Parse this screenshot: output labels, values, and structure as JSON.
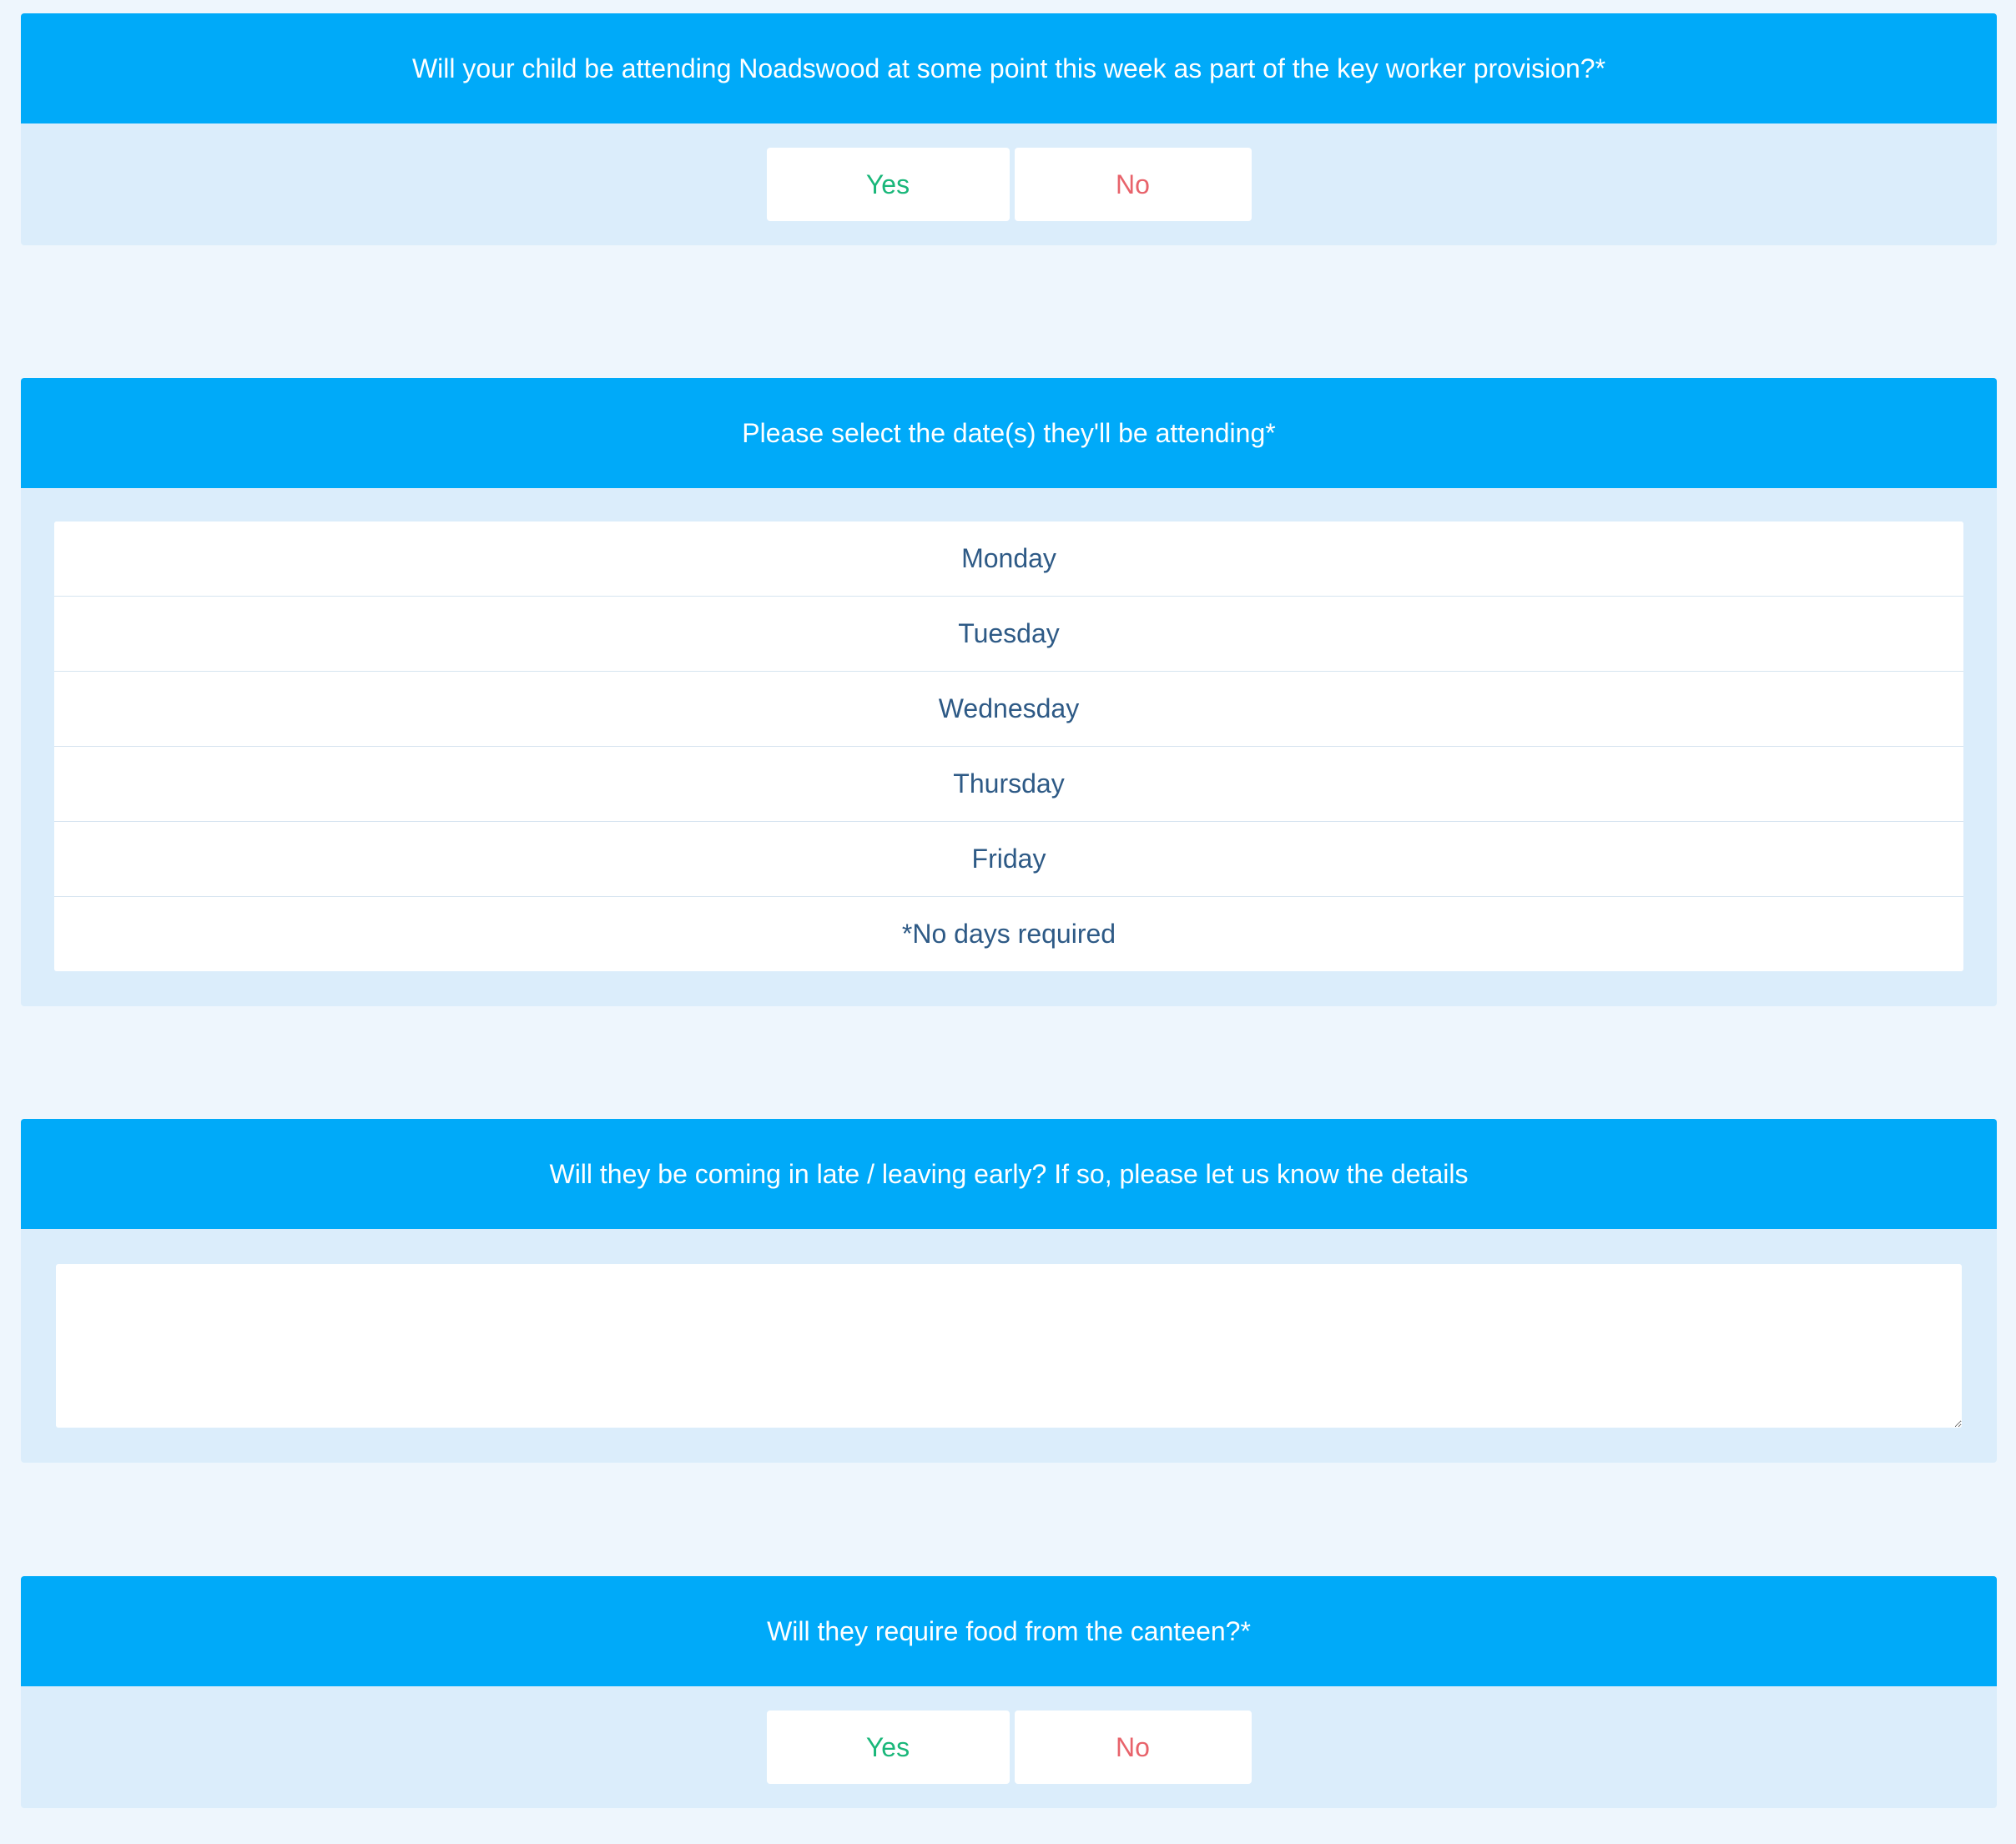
{
  "questions": {
    "attending": {
      "title": "Will your child be attending Noadswood at some point this week as part of the key worker provision?*",
      "yes_label": "Yes",
      "no_label": "No"
    },
    "dates": {
      "title": "Please select the date(s) they'll be attending*",
      "options": [
        "Monday",
        "Tuesday",
        "Wednesday",
        "Thursday",
        "Friday",
        "*No days required"
      ]
    },
    "times": {
      "title": "Will they be coming in late / leaving early? If so, please let us know the details",
      "value": "",
      "placeholder": ""
    },
    "food": {
      "title": "Will they require food from the canteen?*",
      "yes_label": "Yes",
      "no_label": "No"
    }
  },
  "colors": {
    "page_background": "#eef6fd",
    "card_background": "#dbedfb",
    "header_background": "#00aaf9",
    "yes_text": "#1ab77a",
    "no_text": "#e8636b",
    "option_text": "#2e5a86"
  }
}
